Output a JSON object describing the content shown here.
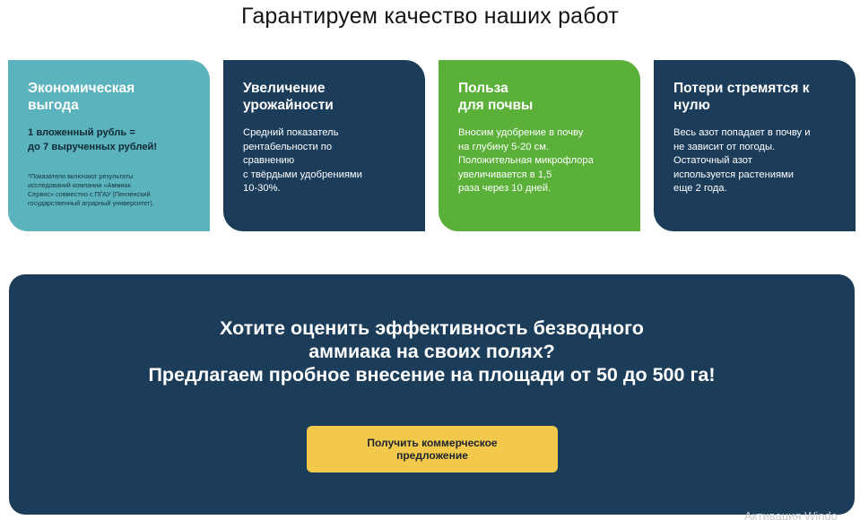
{
  "heading": "Гарантируем качество наших работ",
  "cards": [
    {
      "title": "Экономическая\nвыгода",
      "text": "1 вложенный рубль =\nдо 7 вырученных рублей!",
      "note": "*Показатели включают результаты\nисследований компании «Аммиак\nСервис» совместно с ПГАУ (Пензенский\nгосударственный аграрный университет).",
      "color": "#5ab3bd"
    },
    {
      "title": "Увеличение\nурожайности",
      "text": "Средний показатель\nрентабельности по\nсравнению\nс твёрдыми удобрениями\n 10-30%.",
      "color": "#1c3d5a"
    },
    {
      "title": "Польза\nдля почвы",
      "text": "Вносим удобрение в почву\nна глубину 5-20 см.\nПоложительная микрофлора\nувеличивается в 1,5\nраза через 10 дней.",
      "color": "#5bb03a"
    },
    {
      "title": "Потери стремятся к\nнулю",
      "text": "Весь азот попадает в почву и\nне зависит от погоды.\nОстаточный азот\nиспользуется растениями\nеще 2 года.",
      "color": "#1c3d5a"
    }
  ],
  "cta": {
    "text": "Хотите оценить эффективность безводного\nаммиака на своих полях?\nПредлагаем пробное внесение на площади от 50 до 500 га!",
    "button_label": "Получить коммерческое\nпредложение",
    "background": "#1c3d5a",
    "button_color": "#f3c94b"
  },
  "watermark": "Активация Windo"
}
